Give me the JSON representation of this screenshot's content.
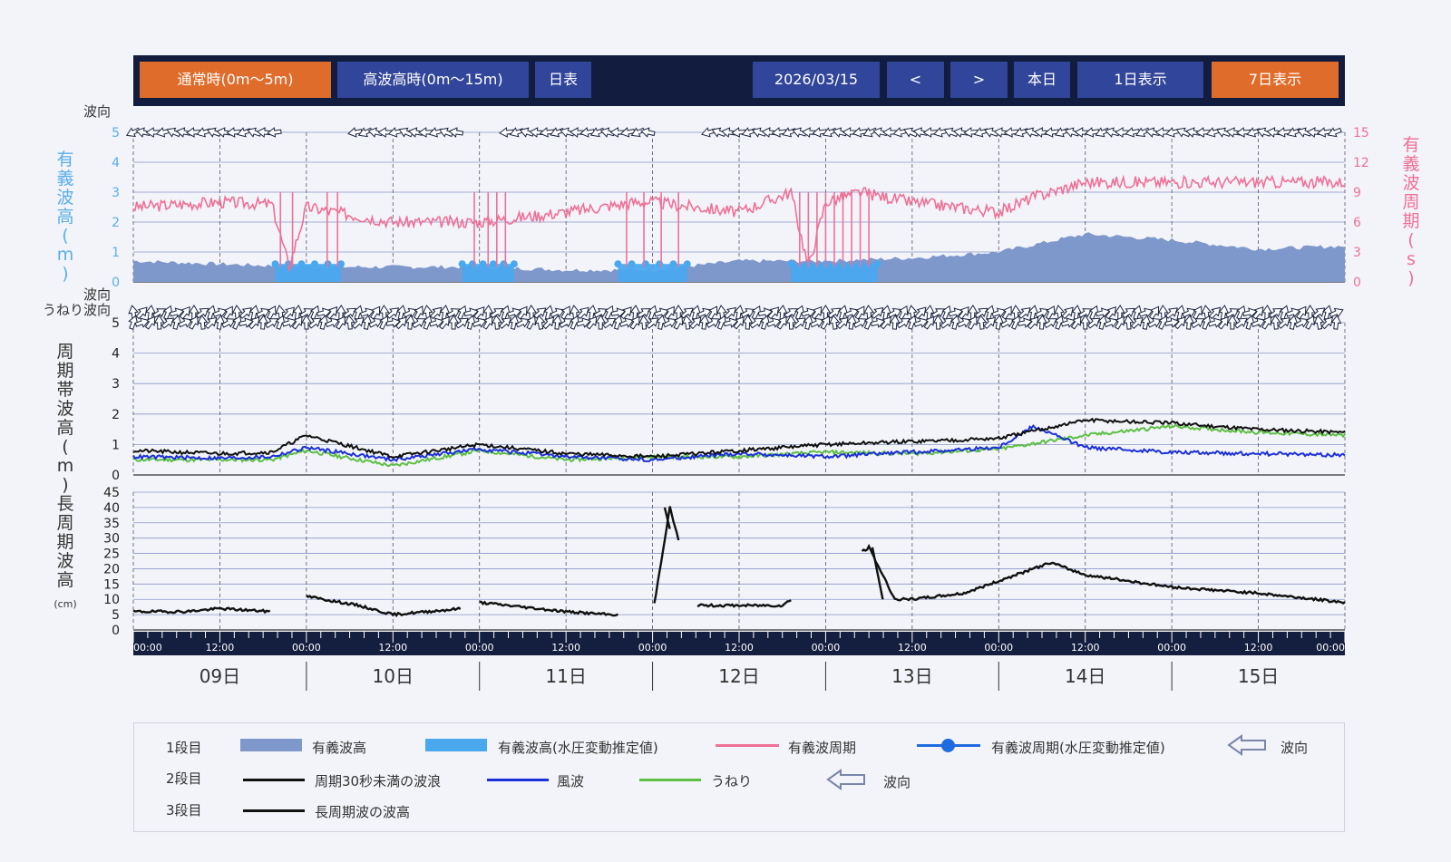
{
  "toolbar": {
    "normal_label": "通常時(0m〜5m)",
    "high_label": "高波高時(0m〜15m)",
    "table_label": "日表",
    "date": "2026/03/15",
    "prev_label": "<",
    "next_label": ">",
    "today_label": "本日",
    "day1_label": "1日表示",
    "day7_label": "7日表示"
  },
  "colors": {
    "wave_height_fill": "#7e98cc",
    "pressure_estimate": "#4aa8ef",
    "period_line": "#ef7096",
    "period_axis": "#ef7096",
    "height_axis": "#5aaee8",
    "wind_wave": "#1c30d8",
    "swell": "#5dbf44",
    "total_under30": "#111111",
    "timeline": "#141e3e"
  },
  "panel1": {
    "direction_label": "波向",
    "left_axis_label": "有義波高(m)",
    "right_axis_label": "有義波周期(s)",
    "left_ticks": [
      "0",
      "1",
      "2",
      "3",
      "4",
      "5"
    ],
    "right_ticks": [
      "0",
      "3",
      "6",
      "9",
      "12",
      "15"
    ]
  },
  "panel2": {
    "direction_label": "波向",
    "swell_direction_label": "うねり波向",
    "axis_label": "周期帯波高(m)",
    "ticks": [
      "0",
      "1",
      "2",
      "3",
      "4",
      "5"
    ]
  },
  "panel3": {
    "axis_label": "長周期波高",
    "unit": "(cm)",
    "ticks": [
      "0",
      "5",
      "10",
      "15",
      "20",
      "25",
      "30",
      "35",
      "40",
      "45"
    ]
  },
  "timeline": {
    "time_labels": [
      "00:00",
      "12:00",
      "00:00",
      "12:00",
      "00:00",
      "12:00",
      "00:00",
      "12:00",
      "00:00",
      "12:00",
      "00:00",
      "12:00",
      "00:00",
      "12:00",
      "00:00"
    ],
    "days": [
      "09日",
      "10日",
      "11日",
      "12日",
      "13日",
      "14日",
      "15日"
    ]
  },
  "legend": {
    "row1": "1段目",
    "row2": "2段目",
    "row3": "3段目",
    "item_height": "有義波高",
    "item_height_est": "有義波高(水圧変動推定値)",
    "item_period": "有義波周期",
    "item_period_est": "有義波周期(水圧変動推定値)",
    "item_dir1": "波向",
    "item_under30": "周期30秒未満の波浪",
    "item_wind": "風波",
    "item_swell": "うねり",
    "item_dir2": "波向",
    "item_long": "長周期波の波高"
  },
  "chart_data": [
    {
      "type": "bar",
      "panel": "top",
      "x_unit": "days (0 = 03/09 00:00)",
      "xlim": [
        0,
        7
      ],
      "ylim": [
        0,
        5
      ],
      "ylim_right": [
        0,
        15
      ],
      "series": [
        {
          "name": "有義波高",
          "x": [
            0,
            0.5,
            1.0,
            1.5,
            2.0,
            2.5,
            3.0,
            3.5,
            4.0,
            4.5,
            5.0,
            5.5,
            6.0,
            6.5,
            7.0
          ],
          "y": [
            0.7,
            0.6,
            0.5,
            0.5,
            0.5,
            0.4,
            0.4,
            0.7,
            0.7,
            0.8,
            1.0,
            1.6,
            1.4,
            1.1,
            1.2
          ]
        },
        {
          "name": "有義波周期",
          "x": [
            0,
            0.5,
            0.8,
            0.9,
            1.0,
            1.5,
            1.9,
            2.0,
            2.5,
            2.9,
            3.0,
            3.5,
            3.8,
            3.9,
            4.0,
            4.2,
            4.5,
            5.0,
            5.2,
            5.5,
            6.0,
            6.5,
            7.0
          ],
          "y": [
            7.5,
            8.0,
            7.8,
            1.5,
            7.5,
            6.0,
            6.0,
            6.0,
            7.0,
            8.0,
            8.0,
            7.0,
            9.0,
            1.5,
            8.0,
            9.0,
            8.0,
            7.0,
            8.5,
            10.0,
            10.0,
            10.0,
            10.0
          ]
        }
      ]
    },
    {
      "type": "line",
      "panel": "middle",
      "xlim": [
        0,
        7
      ],
      "ylim": [
        0,
        5
      ],
      "series": [
        {
          "name": "周期30秒未満の波浪",
          "x": [
            0,
            0.5,
            0.8,
            1.0,
            1.5,
            2.0,
            2.5,
            3.0,
            3.5,
            4.0,
            4.5,
            5.0,
            5.5,
            6.0,
            6.5,
            7.0
          ],
          "y": [
            0.8,
            0.7,
            0.75,
            1.3,
            0.6,
            1.0,
            0.7,
            0.6,
            0.8,
            1.0,
            1.1,
            1.2,
            1.8,
            1.7,
            1.5,
            1.4
          ]
        },
        {
          "name": "風波",
          "x": [
            0,
            0.5,
            0.8,
            1.0,
            1.5,
            2.0,
            2.5,
            3.0,
            3.5,
            4.0,
            4.5,
            5.0,
            5.2,
            5.5,
            6.0,
            6.5,
            7.0
          ],
          "y": [
            0.6,
            0.55,
            0.6,
            0.9,
            0.5,
            0.85,
            0.6,
            0.5,
            0.7,
            0.6,
            0.75,
            0.9,
            1.6,
            0.9,
            0.75,
            0.7,
            0.65
          ]
        },
        {
          "name": "うねり",
          "x": [
            0,
            0.5,
            0.8,
            1.0,
            1.5,
            2.0,
            2.5,
            3.0,
            3.5,
            4.0,
            4.5,
            5.0,
            5.5,
            6.0,
            6.5,
            7.0
          ],
          "y": [
            0.5,
            0.5,
            0.5,
            0.8,
            0.3,
            0.8,
            0.5,
            0.6,
            0.6,
            0.75,
            0.7,
            0.85,
            1.3,
            1.6,
            1.4,
            1.3
          ]
        }
      ]
    },
    {
      "type": "line",
      "panel": "bottom",
      "xlim": [
        0,
        7
      ],
      "ylim": [
        0,
        45
      ],
      "series": [
        {
          "name": "長周期波の波高",
          "x": [
            0,
            0.3,
            0.5,
            0.8,
            1.0,
            1.3,
            1.5,
            1.9,
            2.0,
            2.5,
            2.75,
            3.0,
            3.1,
            3.25,
            3.5,
            3.75,
            4.25,
            4.4,
            4.5,
            4.8,
            5.0,
            5.2,
            5.3,
            5.5,
            6.0,
            6.5,
            7.0
          ],
          "y": [
            6,
            6,
            7,
            6,
            11,
            8,
            5,
            7,
            9,
            6,
            5,
            5,
            40,
            8,
            8,
            8,
            27,
            10,
            10,
            12,
            16,
            20,
            22,
            18,
            14,
            12,
            9
          ]
        }
      ]
    }
  ]
}
